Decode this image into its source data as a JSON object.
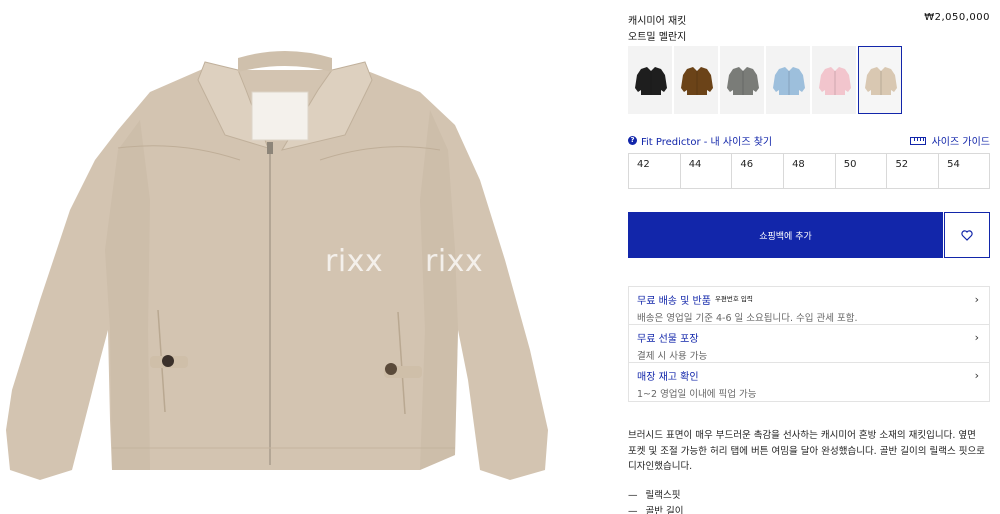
{
  "product": {
    "title": "캐시미어 재킷",
    "price": "₩2,050,000",
    "color_name": "오트밀 멜란지"
  },
  "swatches": [
    {
      "color": "#1e1e1e",
      "label": "black"
    },
    {
      "color": "#6b4318",
      "label": "brown"
    },
    {
      "color": "#7a7c78",
      "label": "grey"
    },
    {
      "color": "#9dbfdc",
      "label": "light-blue"
    },
    {
      "color": "#f2c5cd",
      "label": "pink"
    },
    {
      "color": "#d9c8b2",
      "label": "oatmeal",
      "selected": true
    }
  ],
  "fit": {
    "predictor_label": "Fit Predictor - 내 사이즈 찾기",
    "size_guide_label": "사이즈 가이드"
  },
  "sizes": [
    "42",
    "44",
    "46",
    "48",
    "50",
    "52",
    "54"
  ],
  "cart": {
    "add_label": "쇼핑백에 추가",
    "wishlist_icon": "heart-icon"
  },
  "info": [
    {
      "title": "무료 배송 및 반품",
      "tag": "우편번호 입력",
      "sub": "배송은 영업일 기준 4-6 일 소요됩니다. 수입 관세 포함."
    },
    {
      "title": "무료 선물 포장",
      "tag": "",
      "sub": "결제 시 사용 가능"
    },
    {
      "title": "매장 재고 확인",
      "tag": "",
      "sub": "1~2 영업일 이내에 픽업 가능"
    }
  ],
  "description": {
    "line1": "브러시드 표면이 매우 부드러운 촉감을 선사하는 캐시미어 혼방 소재의 재킷입니다. 옆면",
    "line2": "포켓 및 조절 가능한 허리 탭에 버튼 여밈을 달아 완성했습니다. 골반 길이의 릴랙스 핏으로",
    "line3": "디자인했습니다."
  },
  "bullets": [
    "릴랙스핏",
    "골반 길이"
  ],
  "watermark": "rixx",
  "colors": {
    "accent": "#1226aa",
    "jacket": "#d3c4b1"
  }
}
